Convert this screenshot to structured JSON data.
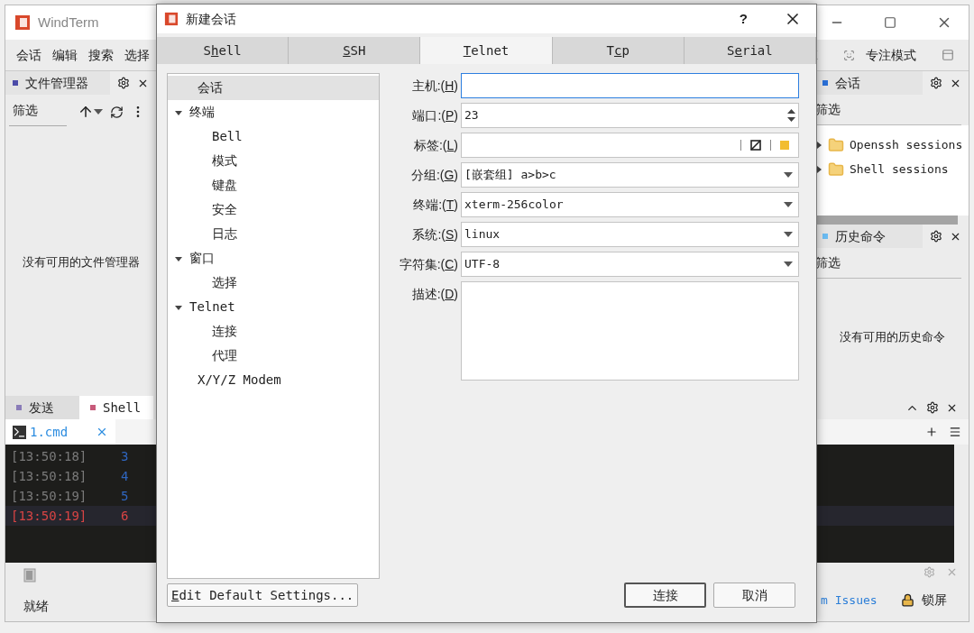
{
  "main_window": {
    "title": "WindTerm",
    "menu": [
      "会话",
      "编辑",
      "搜索",
      "选择"
    ],
    "focus_mode": "专注模式"
  },
  "file_manager": {
    "title": "文件管理器",
    "filter": "筛选",
    "message": "没有可用的文件管理器"
  },
  "sessions_panel": {
    "title": "会话",
    "filter": "筛选",
    "items": [
      {
        "label": "Openssh sessions",
        "expanded": false
      },
      {
        "label": "Shell sessions",
        "expanded": false
      }
    ]
  },
  "history_panel": {
    "title": "历史命令",
    "filter": "筛选",
    "message": "没有可用的历史命令"
  },
  "bottom_tabs": [
    {
      "label": "发送",
      "selected": false
    },
    {
      "label": "Shell",
      "selected": true
    }
  ],
  "terminal": {
    "tab": "1.cmd",
    "lines": [
      {
        "time": "[13:50:18]",
        "num": "3",
        "current": false
      },
      {
        "time": "[13:50:18]",
        "num": "4",
        "current": false
      },
      {
        "time": "[13:50:19]",
        "num": "5",
        "current": false
      },
      {
        "time": "[13:50:19]",
        "num": "6",
        "current": true
      }
    ]
  },
  "status_bar": {
    "text": "就绪",
    "link": "m Issues",
    "lock": "锁屏"
  },
  "dialog": {
    "title": "新建会话",
    "help": "?",
    "tabs": [
      {
        "before": "S",
        "key": "h",
        "after": "ell",
        "selected": false
      },
      {
        "key": "S",
        "after": "SH",
        "selected": false
      },
      {
        "key": "T",
        "after": "elnet",
        "selected": true
      },
      {
        "before": "T",
        "key": "c",
        "after": "p",
        "selected": false
      },
      {
        "before": "S",
        "key": "e",
        "after": "rial",
        "selected": false
      }
    ],
    "tree": [
      {
        "label": "会话",
        "selected": true
      },
      {
        "label": "终端",
        "selected": false,
        "expanded": true,
        "children": [
          {
            "label": "Bell",
            "selected": false
          },
          {
            "label": "模式",
            "selected": false
          },
          {
            "label": "键盘",
            "selected": false
          },
          {
            "label": "安全",
            "selected": false
          },
          {
            "label": "日志",
            "selected": false
          }
        ]
      },
      {
        "label": "窗口",
        "selected": false,
        "expanded": true,
        "children": [
          {
            "label": "选择",
            "selected": false
          }
        ]
      },
      {
        "label": "Telnet",
        "selected": false,
        "expanded": true,
        "children": [
          {
            "label": "连接",
            "selected": false
          },
          {
            "label": "代理",
            "selected": false
          }
        ]
      },
      {
        "label": "X/Y/Z Modem",
        "selected": false
      }
    ],
    "fields": [
      {
        "kind": "text",
        "label": "主机:(",
        "key": "H",
        "after": ")",
        "focused": true
      },
      {
        "kind": "spin",
        "label": "端口:(",
        "key": "P",
        "after": ")",
        "value": "23",
        "focused": false
      },
      {
        "kind": "tag",
        "label": "标签:(",
        "key": "L",
        "after": ")",
        "focused": false
      },
      {
        "kind": "select",
        "label": "分组:(",
        "key": "G",
        "after": ")",
        "value": "[嵌套组] a>b>c",
        "focused": false
      },
      {
        "kind": "select",
        "label": "终端:(",
        "key": "T",
        "after": ")",
        "value": "xterm-256color",
        "focused": false
      },
      {
        "kind": "select",
        "label": "系统:(",
        "key": "S",
        "after": ")",
        "value": "linux",
        "focused": false
      },
      {
        "kind": "select",
        "label": "字符集:(",
        "key": "C",
        "after": ")",
        "value": "UTF-8",
        "focused": false
      },
      {
        "kind": "textarea",
        "label": "描述:(",
        "key": "D",
        "after": ")",
        "focused": false
      }
    ],
    "edit_defaults": {
      "key": "E",
      "after": "dit Default Settings..."
    },
    "buttons": [
      {
        "label": "连接",
        "default": true
      },
      {
        "label": "取消",
        "default": false
      }
    ]
  }
}
